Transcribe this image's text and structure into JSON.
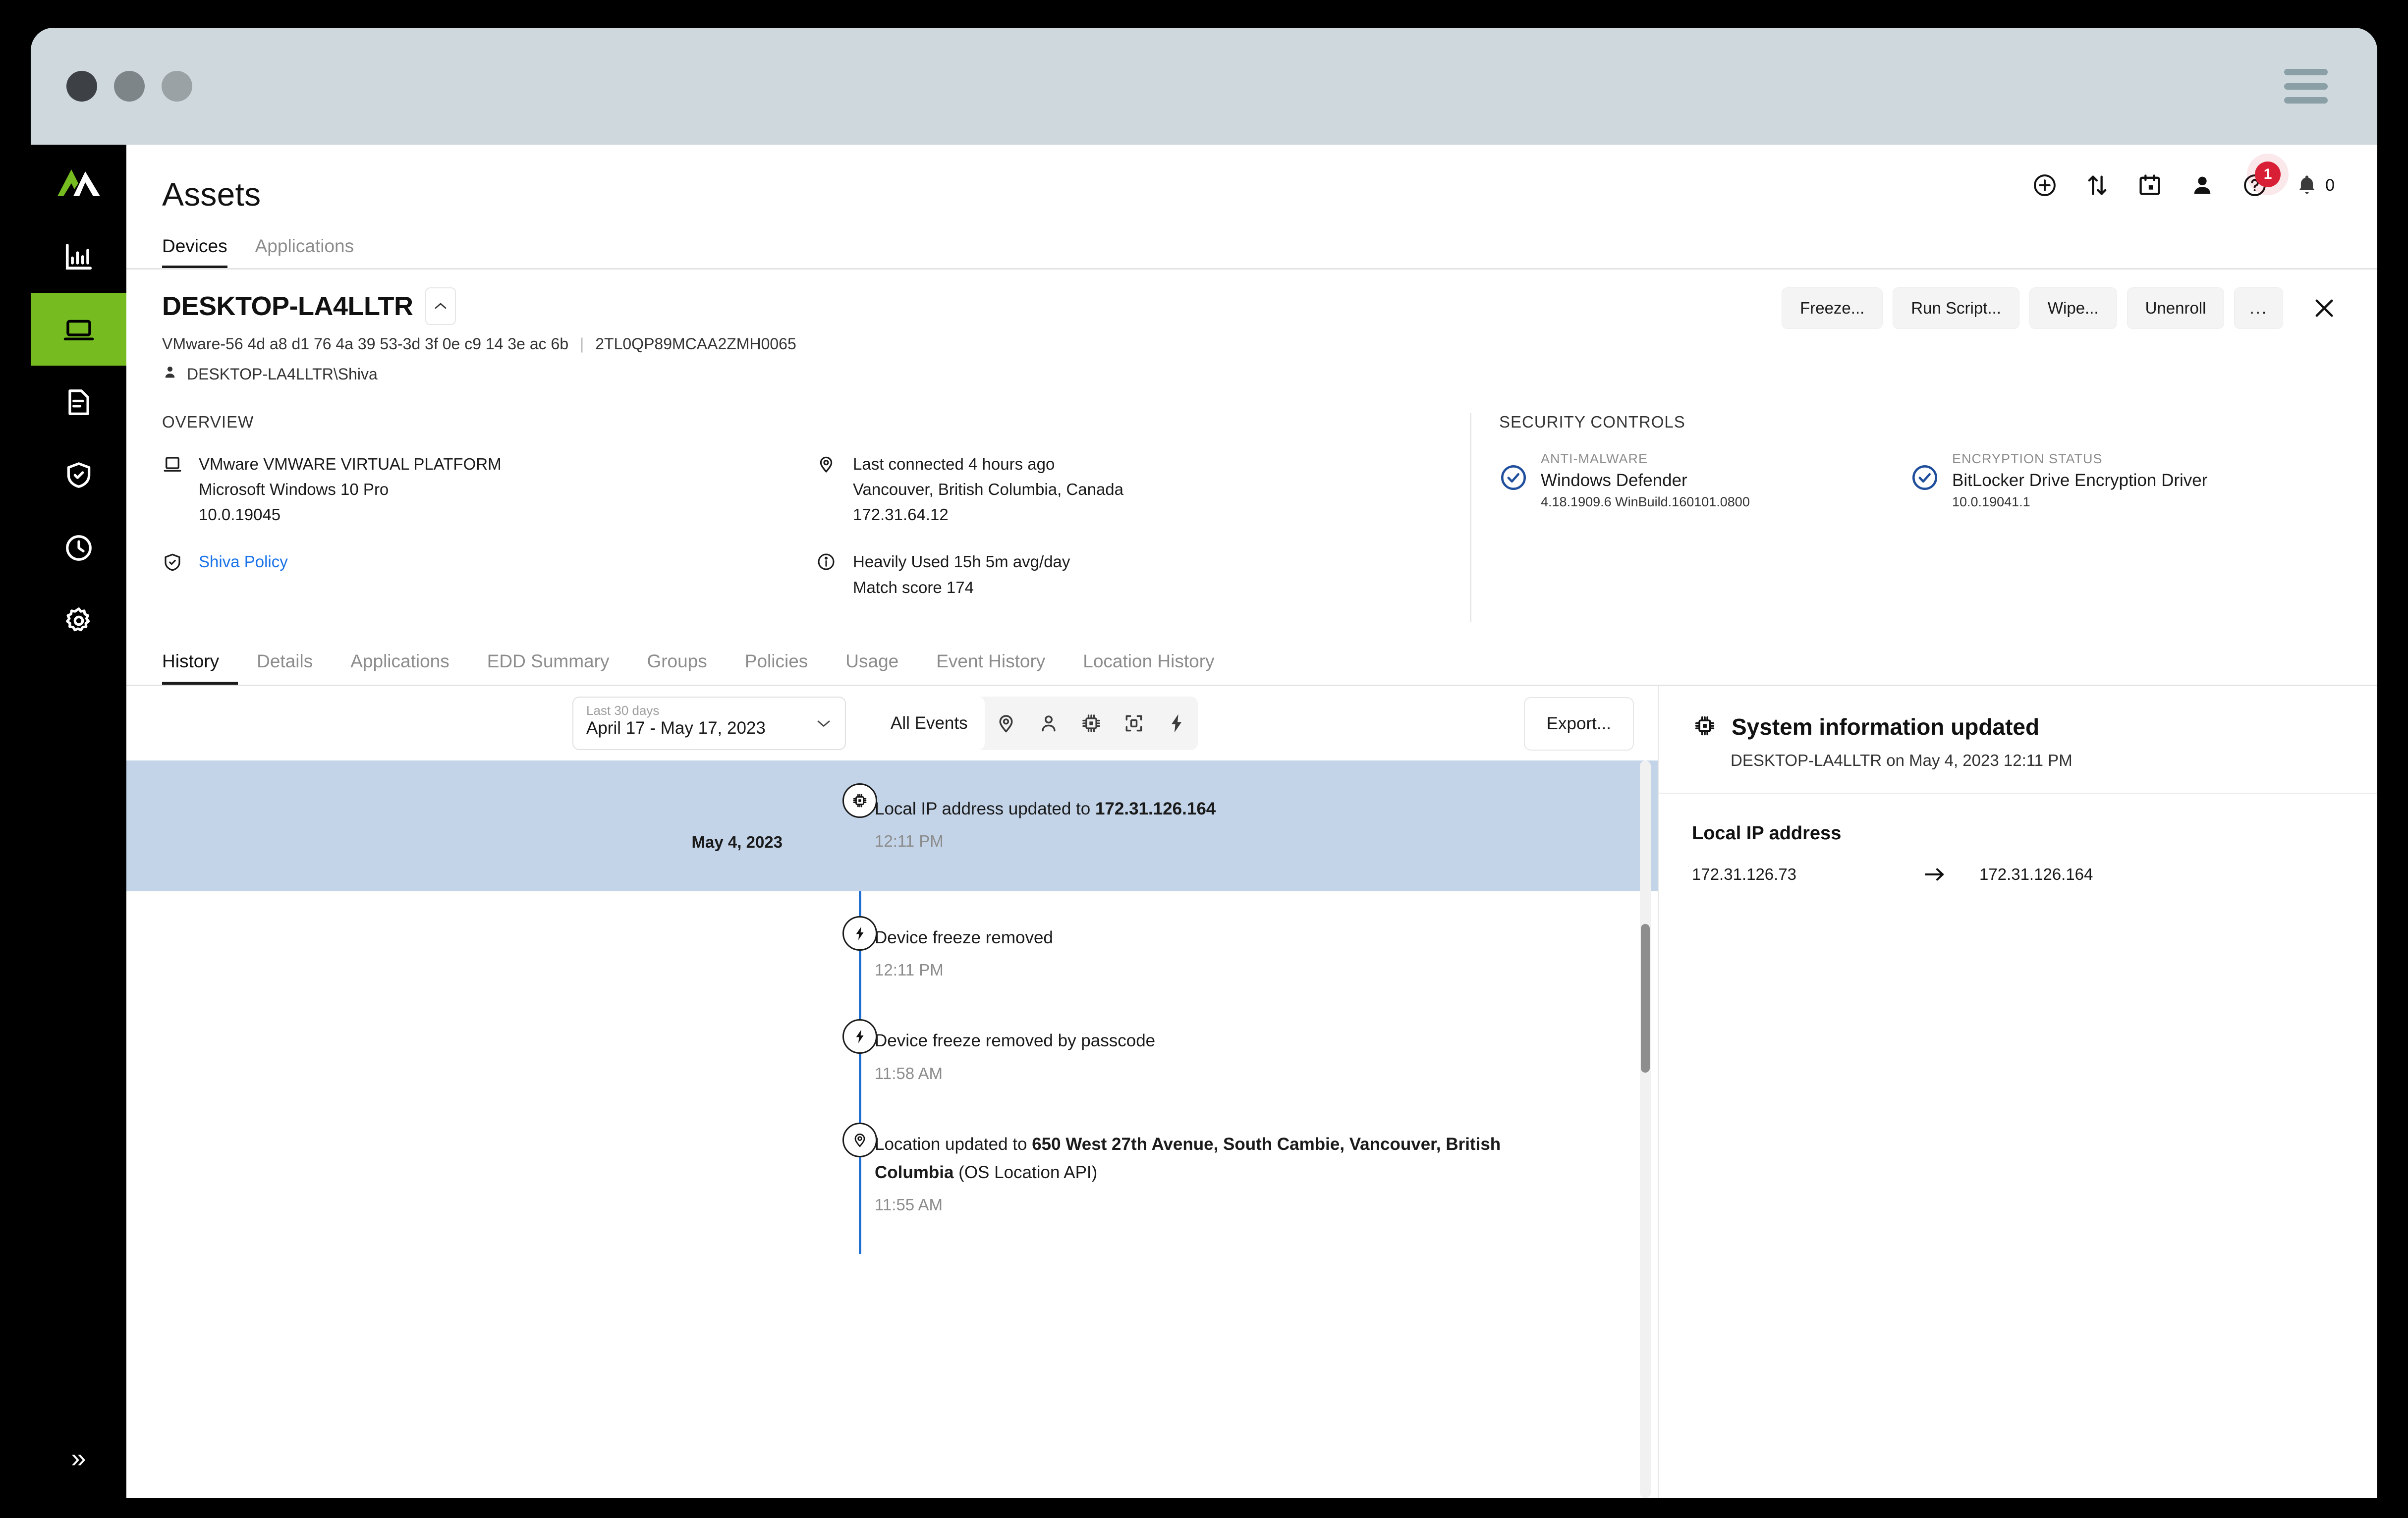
{
  "window": {
    "traffic_lights": [
      "close",
      "minimize",
      "maximize"
    ],
    "menu_icon": "hamburger-icon"
  },
  "sidebar": {
    "logo": "absolute-logo",
    "items": [
      {
        "name": "reports",
        "icon": "bar-chart-icon",
        "active": false
      },
      {
        "name": "assets",
        "icon": "laptop-icon",
        "active": true
      },
      {
        "name": "documents",
        "icon": "document-icon",
        "active": false
      },
      {
        "name": "security",
        "icon": "shield-check-icon",
        "active": false
      },
      {
        "name": "history",
        "icon": "clock-icon",
        "active": false
      },
      {
        "name": "settings",
        "icon": "gear-icon",
        "active": false
      }
    ],
    "collapse_label": "»"
  },
  "header": {
    "title": "Assets",
    "icons": [
      {
        "name": "add-icon",
        "glyph": "plus-circle"
      },
      {
        "name": "transfer-icon",
        "glyph": "up-down-arrows"
      },
      {
        "name": "calendar-icon",
        "glyph": "calendar"
      },
      {
        "name": "user-icon",
        "glyph": "person"
      },
      {
        "name": "help-icon",
        "glyph": "question-circle",
        "badge": "1"
      },
      {
        "name": "notifications-icon",
        "glyph": "bell",
        "count": "0"
      }
    ],
    "help_badge": "1",
    "notification_count": "0"
  },
  "top_tabs": [
    {
      "label": "Devices",
      "active": true
    },
    {
      "label": "Applications",
      "active": false
    }
  ],
  "device": {
    "name": "DESKTOP-LA4LLTR",
    "collapse_icon": "chevron-up-icon",
    "identifiers": "VMware-56 4d a8 d1 76 4a 39 53-3d 3f 0e c9 14 3e ac 6b",
    "serial": "2TL0QP89MCAA2ZMH0065",
    "user": "DESKTOP-LA4LLTR\\Shiva",
    "actions": [
      {
        "label": "Freeze...",
        "name": "freeze-button"
      },
      {
        "label": "Run Script...",
        "name": "run-script-button"
      },
      {
        "label": "Wipe...",
        "name": "wipe-button"
      },
      {
        "label": "Unenroll",
        "name": "unenroll-button"
      },
      {
        "label": "...",
        "name": "more-actions-button"
      }
    ],
    "close_label": "✕"
  },
  "overview": {
    "section_label": "OVERVIEW",
    "hardware": {
      "icon": "laptop-icon",
      "model": "VMware VMWARE VIRTUAL PLATFORM",
      "os": "Microsoft Windows 10 Pro",
      "build": "10.0.19045"
    },
    "policy": {
      "icon": "shield-check-icon",
      "label": "Shiva Policy",
      "color": "#1a73e8"
    },
    "location": {
      "icon": "map-pin-icon",
      "last_connected": "Last connected 4 hours ago",
      "place": "Vancouver, British Columbia, Canada",
      "ip": "172.31.64.12"
    },
    "usage": {
      "icon": "info-icon",
      "usage": "Heavily Used 15h 5m avg/day",
      "match_score": "Match score 174"
    }
  },
  "security_controls": {
    "section_label": "SECURITY CONTROLS",
    "items": [
      {
        "kind": "ANTI-MALWARE",
        "name": "Windows Defender",
        "version": "4.18.1909.6 WinBuild.160101.0800",
        "status_icon": "check-circle-icon",
        "status_color": "#1f4e9c"
      },
      {
        "kind": "ENCRYPTION STATUS",
        "name": "BitLocker Drive Encryption Driver",
        "version": "10.0.19041.1",
        "status_icon": "check-circle-icon",
        "status_color": "#1f4e9c"
      }
    ]
  },
  "sub_tabs": [
    {
      "label": "History",
      "active": true
    },
    {
      "label": "Details",
      "active": false
    },
    {
      "label": "Applications",
      "active": false
    },
    {
      "label": "EDD Summary",
      "active": false
    },
    {
      "label": "Groups",
      "active": false
    },
    {
      "label": "Policies",
      "active": false
    },
    {
      "label": "Usage",
      "active": false
    },
    {
      "label": "Event History",
      "active": false
    },
    {
      "label": "Location History",
      "active": false
    }
  ],
  "timeline_toolbar": {
    "date_range": {
      "label": "Last 30 days",
      "value": "April 17 - May 17, 2023",
      "chevron": "chevron-down-icon"
    },
    "event_filter": {
      "selected": "All Events",
      "icons": [
        {
          "name": "location-filter-icon",
          "glyph": "map-pin"
        },
        {
          "name": "user-filter-icon",
          "glyph": "person"
        },
        {
          "name": "system-filter-icon",
          "glyph": "chip"
        },
        {
          "name": "device-filter-icon",
          "glyph": "scan-frame"
        },
        {
          "name": "action-filter-icon",
          "glyph": "bolt"
        }
      ]
    },
    "export_label": "Export..."
  },
  "timeline": {
    "events": [
      {
        "date": "May 4, 2023",
        "icon": "chip-icon",
        "text_prefix": "Local IP address updated to ",
        "text_bold": "172.31.126.164",
        "text_suffix": "",
        "time": "12:11 PM",
        "selected": true
      },
      {
        "date": "",
        "icon": "bolt-icon",
        "text_prefix": "Device freeze removed",
        "text_bold": "",
        "text_suffix": "",
        "time": "12:11 PM",
        "selected": false
      },
      {
        "date": "",
        "icon": "bolt-icon",
        "text_prefix": "Device freeze removed by passcode",
        "text_bold": "",
        "text_suffix": "",
        "time": "11:58 AM",
        "selected": false
      },
      {
        "date": "",
        "icon": "map-pin-icon",
        "text_prefix": "Location updated to ",
        "text_bold": "650 West 27th Avenue, South Cambie, Vancouver, British Columbia",
        "text_suffix": " (OS Location API)",
        "time": "11:55 AM",
        "selected": false
      }
    ]
  },
  "detail_panel": {
    "icon": "chip-icon",
    "title": "System information updated",
    "subtitle": "DESKTOP-LA4LLTR on May 4, 2023 12:11 PM",
    "field_label": "Local IP address",
    "old_value": "172.31.126.73",
    "arrow": "→",
    "new_value": "172.31.126.164"
  }
}
